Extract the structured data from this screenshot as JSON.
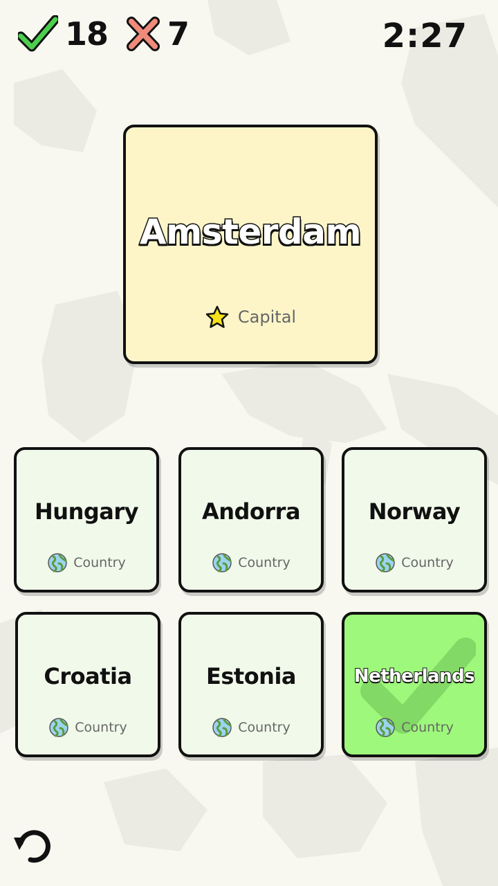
{
  "score": {
    "correct_count": "18",
    "wrong_count": "7",
    "correct_icon": "check-icon",
    "wrong_icon": "cross-icon",
    "correct_color": "#4ccf4c",
    "wrong_color": "#f08a7a"
  },
  "timer": "2:27",
  "question": {
    "title": "Amsterdam",
    "category_label": "Capital",
    "category_icon": "star-icon",
    "background": "#fdf5c8"
  },
  "options": [
    {
      "name": "Hungary",
      "label": "Country",
      "icon": "globe-icon"
    },
    {
      "name": "Andorra",
      "label": "Country",
      "icon": "globe-icon"
    },
    {
      "name": "Norway",
      "label": "Country",
      "icon": "globe-icon"
    },
    {
      "name": "Croatia",
      "label": "Country",
      "icon": "globe-icon"
    },
    {
      "name": "Estonia",
      "label": "Country",
      "icon": "globe-icon"
    },
    {
      "name": "Netherlands",
      "label": "Country",
      "icon": "globe-icon",
      "state": "selected-correct"
    }
  ],
  "colors": {
    "option_bg": "#f1f9ea",
    "selected_bg": "#9ef87b",
    "page_bg": "#f8f8f1"
  },
  "undo_icon": "undo-icon"
}
